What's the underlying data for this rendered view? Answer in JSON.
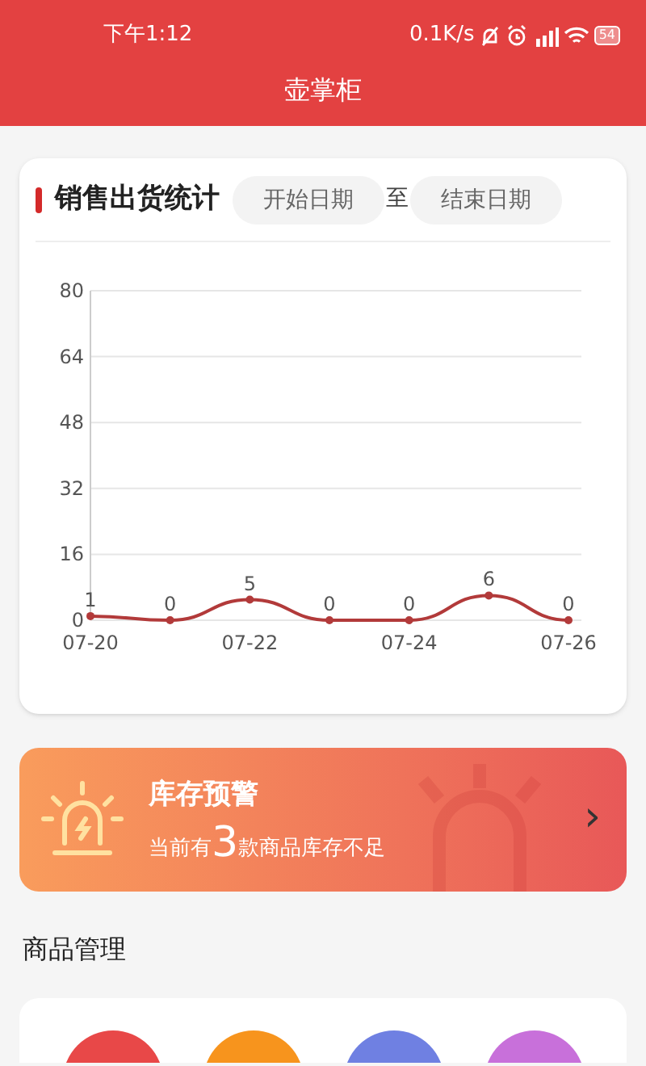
{
  "status_bar": {
    "time": "下午1:12",
    "speed": "0.1K/s",
    "battery": "54"
  },
  "app_title": "壶掌柜",
  "sales_card": {
    "title": "销售出货统计",
    "start_date": {
      "placeholder": "开始日期"
    },
    "separator": "至",
    "end_date": {
      "placeholder": "结束日期"
    },
    "chart_data": {
      "type": "line",
      "categories": [
        "07-20",
        null,
        "07-22",
        null,
        "07-24",
        null,
        "07-26"
      ],
      "series": [
        {
          "color": "#b23a3a",
          "values": [
            1,
            0,
            5,
            0,
            0,
            6,
            0
          ]
        }
      ],
      "ylim": [
        0,
        80
      ],
      "yticks": [
        0,
        16,
        32,
        48,
        64,
        80
      ],
      "grid": true,
      "marker": "circle",
      "data_labels": true
    }
  },
  "stock_alert": {
    "title": "库存预警",
    "prefix": "当前有",
    "count": "3",
    "suffix": "款商品库存不足",
    "arrow": "›"
  },
  "section_title": "商品管理",
  "product_tiles": [
    {
      "color": "#e84848"
    },
    {
      "color": "#f7941d"
    },
    {
      "color": "#6f80e2"
    },
    {
      "color": "#c870da"
    }
  ]
}
